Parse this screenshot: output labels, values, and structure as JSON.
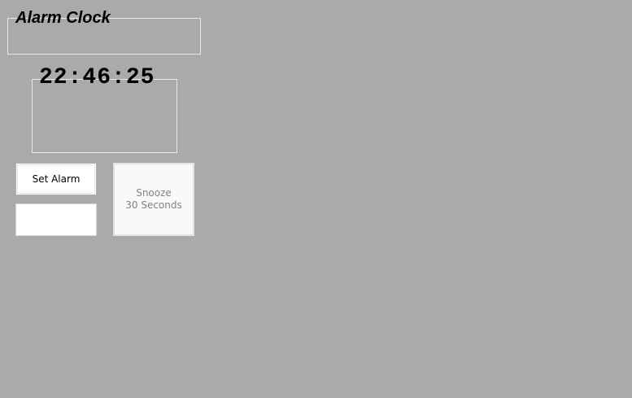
{
  "app": {
    "title": "Alarm Clock"
  },
  "clock": {
    "time": "22:46:25"
  },
  "controls": {
    "set_alarm_label": "Set Alarm",
    "alarm_time_value": "",
    "snooze_line1": "Snooze",
    "snooze_line2": "30 Seconds"
  },
  "colors": {
    "background": "#aaaaaa",
    "group_border": "#e8e8e8",
    "button_face": "#ffffff",
    "disabled_button_face": "#f9f9f9",
    "disabled_text": "#838383"
  }
}
